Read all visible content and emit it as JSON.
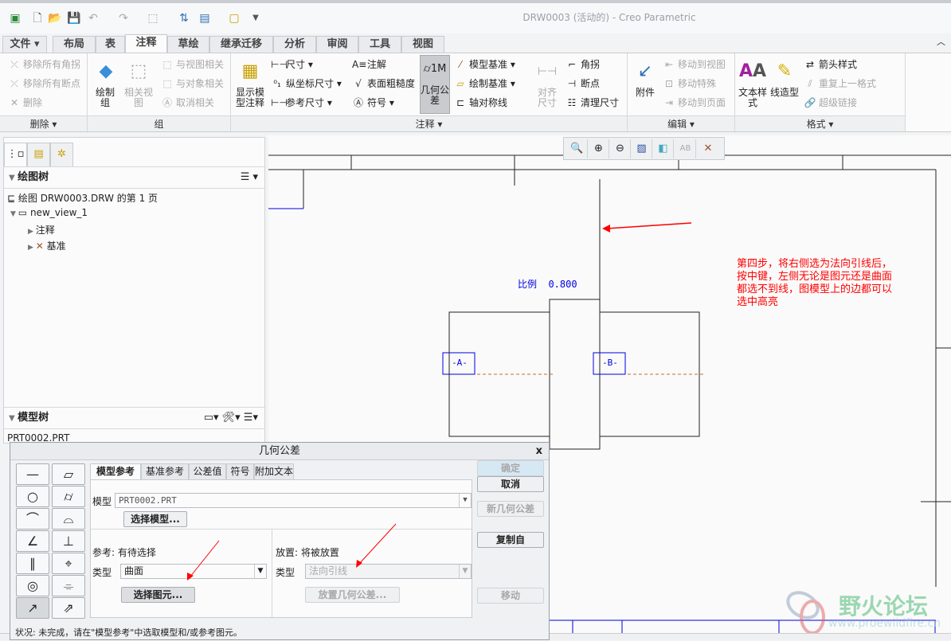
{
  "window": {
    "title": "DRW0003 (活动的) - Creo Parametric"
  },
  "tabs": [
    "文件 ▾",
    "布局",
    "表",
    "注释",
    "草绘",
    "继承迁移",
    "分析",
    "审阅",
    "工具",
    "视图"
  ],
  "ribbon": {
    "delete_group": {
      "label": "删除 ▾",
      "items": [
        "移除所有角拐",
        "移除所有断点",
        "删除"
      ]
    },
    "group_group": {
      "label": "组",
      "draw_group": "绘制组",
      "related_view": "相关视图",
      "items": [
        "与视图相关",
        "与对象相关",
        "取消相关"
      ]
    },
    "annot_group": {
      "label": "注释 ▾",
      "show_model_annot": "显示模型注释",
      "col1": [
        "尺寸 ▾",
        "纵坐标尺寸 ▾",
        "参考尺寸 ▾"
      ],
      "col2": [
        "注解",
        "表面粗糙度",
        "符号 ▾"
      ],
      "gtol": "几何公差",
      "col3": [
        "模型基准 ▾",
        "绘制基准 ▾",
        "轴对称线"
      ],
      "align_dim": "对齐尺寸",
      "col4": [
        "角拐",
        "断点",
        "清理尺寸"
      ]
    },
    "edit_group": {
      "label": "编辑 ▾",
      "attach": "附件",
      "items": [
        "移动到视图",
        "移动特殊",
        "移动到页面"
      ]
    },
    "format_group": {
      "label": "格式 ▾",
      "text_style": "文本样式",
      "line_style": "线造型",
      "items": [
        "箭头样式",
        "重复上一格式",
        "超级链接"
      ]
    }
  },
  "left_panel": {
    "drawing_tree": {
      "title": "绘图树",
      "items": [
        "绘图 DRW0003.DRW 的第 1 页",
        "new_view_1",
        "注释",
        "基准"
      ]
    },
    "model_tree": {
      "title": "模型树",
      "items": [
        "PRT0002.PRT"
      ]
    }
  },
  "drawing": {
    "scale_label": "比例  0.800",
    "datum_a": "-A-",
    "datum_b": "-B-",
    "note": [
      "第四步，将右侧选为法向引线后，",
      "按中键，左侧无论是图元还是曲面",
      "都选不到线，图模型上的边都可以",
      "选中高亮"
    ],
    "watermark": "野火论坛",
    "watermark_url": "www.proewildfire.cn"
  },
  "dialog": {
    "title": "几何公差",
    "close": "x",
    "tabs": [
      "模型参考",
      "基准参考",
      "公差值",
      "符号",
      "附加文本"
    ],
    "model_label": "模型",
    "model_value": "PRT0002.PRT",
    "select_model": "选择模型...",
    "ref_label": "参考: 有待选择",
    "ref_type_label": "类型",
    "ref_type_value": "曲面",
    "select_entity": "选择图元...",
    "place_label": "放置: 将被放置",
    "place_type_label": "类型",
    "place_type_value": "法向引线",
    "place_gtol": "放置几何公差...",
    "buttons": {
      "ok": "确定",
      "cancel": "取消",
      "new": "新几何公差",
      "copy_from": "复制自",
      "move": "移动"
    },
    "status": "状况: 未完成，请在\"模型参考\"中选取模型和/或参考图元。"
  },
  "colors": {
    "annotation_red": "#ff0000",
    "datum_blue": "#0000e0",
    "centerline": "#c07030"
  }
}
